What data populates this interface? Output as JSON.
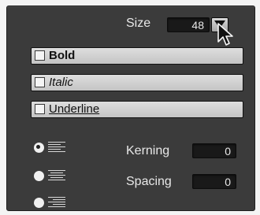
{
  "size": {
    "label": "Size",
    "value": "48"
  },
  "style_buttons": [
    {
      "label": "Bold",
      "checked": false
    },
    {
      "label": "Italic",
      "checked": false
    },
    {
      "label": "Underline",
      "checked": false
    }
  ],
  "alignment": [
    {
      "name": "align-left",
      "selected": true
    },
    {
      "name": "align-center",
      "selected": false
    },
    {
      "name": "align-right",
      "selected": false
    }
  ],
  "kerning": {
    "label": "Kerning",
    "value": "0"
  },
  "spacing": {
    "label": "Spacing",
    "value": "0"
  },
  "icons": [
    "chevron-down-icon",
    "mouse-pointer-icon",
    "checkbox-icon",
    "align-left-icon",
    "align-center-icon",
    "align-right-icon"
  ],
  "colors": {
    "panel": "#3b3b3b",
    "field": "#191919",
    "button": "#d4d4d4",
    "text": "#e8e8e8"
  }
}
